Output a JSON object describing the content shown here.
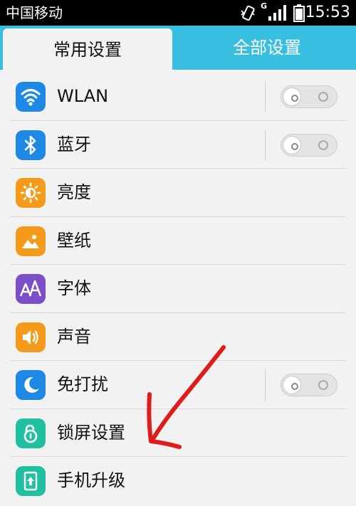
{
  "status_bar": {
    "carrier": "中国移动",
    "network_type": "G",
    "time": "15:53",
    "icons": [
      "vibrate-icon",
      "signal-icon",
      "battery-icon"
    ]
  },
  "tabs": [
    {
      "label": "常用设置",
      "active": true
    },
    {
      "label": "全部设置",
      "active": false
    }
  ],
  "settings": [
    {
      "label": "WLAN",
      "icon": "wifi-icon",
      "color": "#1e88e5",
      "toggle": "off"
    },
    {
      "label": "蓝牙",
      "icon": "bluetooth-icon",
      "color": "#1e88e5",
      "toggle": "off"
    },
    {
      "label": "亮度",
      "icon": "brightness-icon",
      "color": "#f59b1b"
    },
    {
      "label": "壁纸",
      "icon": "wallpaper-icon",
      "color": "#f59b1b"
    },
    {
      "label": "字体",
      "icon": "font-icon",
      "color": "#7b4fc9"
    },
    {
      "label": "声音",
      "icon": "sound-icon",
      "color": "#f59b1b"
    },
    {
      "label": "免打扰",
      "icon": "moon-icon",
      "color": "#1e88e5",
      "toggle": "off"
    },
    {
      "label": "锁屏设置",
      "icon": "unlock-icon",
      "color": "#20c0a0"
    },
    {
      "label": "手机升级",
      "icon": "upgrade-icon",
      "color": "#20c0a0"
    }
  ],
  "colors": {
    "tab_bar": "#38bfe0",
    "background": "#f2f2f2",
    "annotation_arrow": "#e01b1b"
  }
}
